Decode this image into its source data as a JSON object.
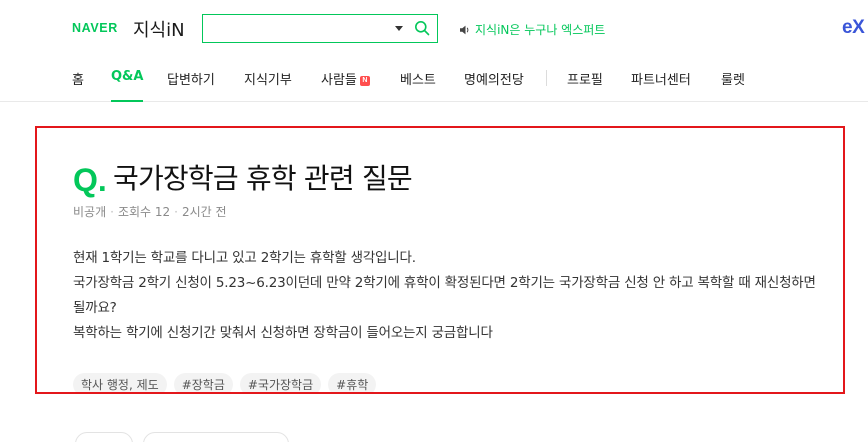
{
  "header": {
    "brand": "NAVER",
    "service": "지식iN",
    "search": {
      "value": "",
      "placeholder": ""
    },
    "notice": "지식iN은 누구나 엑스퍼트",
    "ex_logo": "eX"
  },
  "nav": {
    "items": [
      {
        "label": "홈"
      },
      {
        "label": "Q&A",
        "active": true
      },
      {
        "label": "답변하기"
      },
      {
        "label": "지식기부"
      },
      {
        "label": "사람들",
        "badge": "N"
      },
      {
        "label": "베스트"
      },
      {
        "label": "명예의전당"
      },
      {
        "label": "프로필"
      },
      {
        "label": "파트너센터"
      },
      {
        "label": "룰렛"
      }
    ]
  },
  "question": {
    "q_mark": "Q.",
    "title": "국가장학금 휴학 관련 질문",
    "author": "비공개",
    "views": "조회수 12",
    "time": "2시간 전",
    "body": [
      "현재 1학기는 학교를 다니고 있고 2학기는 휴학할 생각입니다.",
      "국가장학금 2학기 신청이 5.23~6.23이던데 만약 2학기에 휴학이 확정된다면 2학기는 국가장학금 신청 안 하고 복학할 때 재신청하면 될까요?",
      "복학하는 학기에 신청기간 맞춰서 신청하면 장학금이 들어오는지 궁금합니다"
    ],
    "tags": [
      "학사 행정, 제도",
      "#장학금",
      "#국가장학금",
      "#휴학"
    ]
  },
  "colors": {
    "accent": "#03c75a",
    "highlight_border": "#e3171b",
    "badge": "#ff4e4e",
    "ex_logo": "#3a55d8"
  }
}
